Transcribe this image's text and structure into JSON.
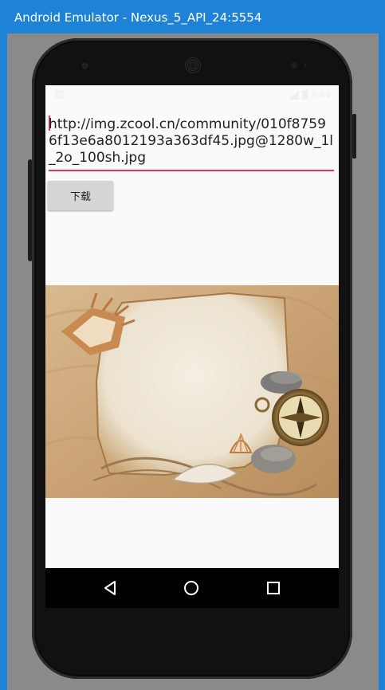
{
  "window": {
    "title": "Android Emulator - Nexus_5_API_24:5554"
  },
  "status_bar": {
    "time": "3:44"
  },
  "url_field": {
    "value": "http://img.zcool.cn/community/010f87596f13e6a8012193a363df45.jpg@1280w_1l_2o_100sh.jpg"
  },
  "download_button": {
    "label": "下载"
  },
  "image_view": {
    "icon": "beach-parchment-image"
  },
  "nav_bar": {
    "back_icon": "back-triangle-icon",
    "home_icon": "home-circle-icon",
    "recent_icon": "recent-square-icon"
  },
  "colors": {
    "title_bar": "#1e83d6",
    "accent": "#e0336b",
    "screen_bg": "#fafafa",
    "button_bg": "#d6d6d6"
  }
}
